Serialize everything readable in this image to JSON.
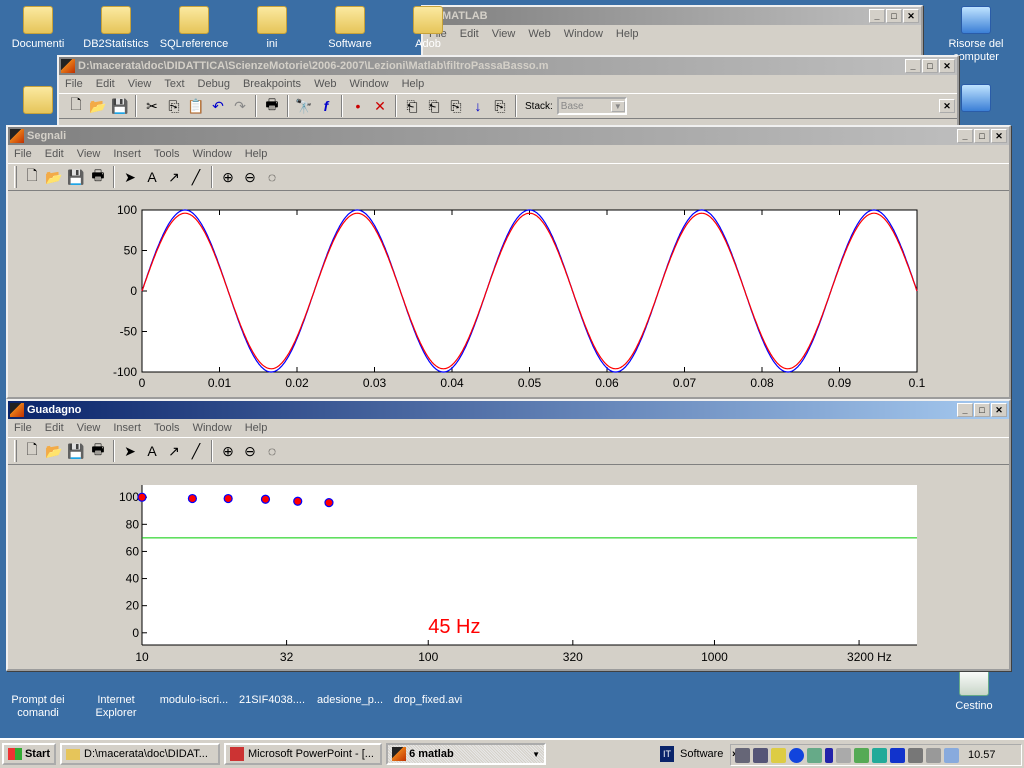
{
  "desktop": {
    "icons_top": [
      "Documenti",
      "DB2Statistics",
      "SQLreference",
      "ini",
      "Software",
      "Adob"
    ],
    "icons_right": [
      "Risorse del computer"
    ],
    "icons_bottom": [
      "Prompt dei comandi",
      "Internet Explorer",
      "modulo-iscri...",
      "21SIF4038....",
      "adesione_p...",
      "drop_fixed.avi"
    ],
    "recycle": "Cestino"
  },
  "matlab": {
    "title": "MATLAB",
    "menu": [
      "File",
      "Edit",
      "View",
      "Web",
      "Window",
      "Help"
    ]
  },
  "editor": {
    "title": "D:\\macerata\\doc\\DIDATTICA\\ScienzeMotorie\\2006-2007\\Lezioni\\Matlab\\filtroPassaBasso.m",
    "menu": [
      "File",
      "Edit",
      "View",
      "Text",
      "Debug",
      "Breakpoints",
      "Web",
      "Window",
      "Help"
    ],
    "stack_label": "Stack:",
    "stack_value": "Base"
  },
  "segnali": {
    "title": "Segnali",
    "menu": [
      "File",
      "Edit",
      "View",
      "Insert",
      "Tools",
      "Window",
      "Help"
    ]
  },
  "guadagno": {
    "title": "Guadagno",
    "menu": [
      "File",
      "Edit",
      "View",
      "Insert",
      "Tools",
      "Window",
      "Help"
    ]
  },
  "chart_data": [
    {
      "type": "line",
      "xlim": [
        0,
        0.1
      ],
      "ylim": [
        -100,
        100
      ],
      "xticks": [
        "0",
        "0.01",
        "0.02",
        "0.03",
        "0.04",
        "0.05",
        "0.06",
        "0.07",
        "0.08",
        "0.09",
        "0.1"
      ],
      "yticks": [
        "100",
        "50",
        "0",
        "-50",
        "-100"
      ],
      "series": [
        {
          "frequency_hz": 45,
          "amplitude": 100,
          "color": "#0000ff"
        },
        {
          "frequency_hz": 45,
          "amplitude": 96,
          "color": "#ff0000"
        }
      ]
    },
    {
      "type": "scatter",
      "xscale": "log",
      "xlim": [
        10,
        5100
      ],
      "ylim": [
        -9,
        109
      ],
      "xticks": [
        {
          "v": 10,
          "label": "10"
        },
        {
          "v": 32,
          "label": "32"
        },
        {
          "v": 100,
          "label": "100"
        },
        {
          "v": 320,
          "label": "320"
        },
        {
          "v": 1000,
          "label": "1000"
        },
        {
          "v": 3200,
          "label": "3200 Hz"
        }
      ],
      "yticks": [
        "100",
        "80",
        "60",
        "40",
        "20",
        "0"
      ],
      "points": {
        "x": [
          10,
          15,
          20,
          27,
          35,
          45
        ],
        "y": [
          100,
          99,
          99,
          98.5,
          97,
          96
        ]
      },
      "marker_color": "#ff0000",
      "marker_edge": "#0000ff",
      "reference_line": {
        "y": 70,
        "color": "#00cc00"
      },
      "annotation": "45 Hz",
      "annotation_color": "#ff0000"
    }
  ],
  "taskbar": {
    "start": "Start",
    "buttons": [
      "D:\\macerata\\doc\\DIDAT...",
      "Microsoft PowerPoint - [...",
      "6 matlab"
    ],
    "toolbar": "Software",
    "clock": "10.57"
  }
}
